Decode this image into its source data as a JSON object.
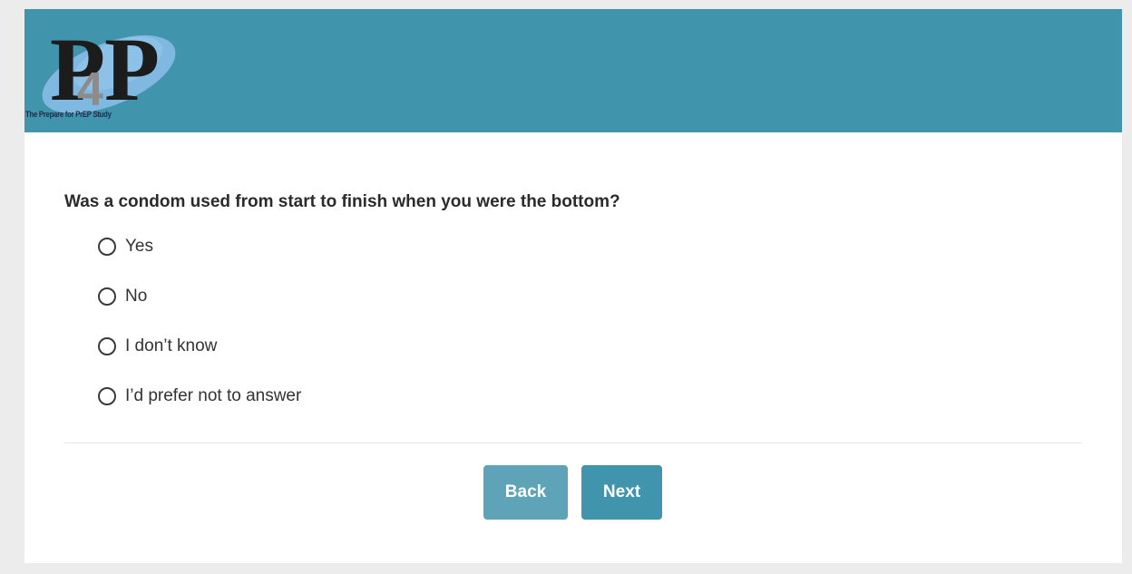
{
  "header": {
    "logo_text": "P4P",
    "tagline": "The Prepare for PrEP Study",
    "background_color": "#4095ad"
  },
  "question": {
    "text": "Was a condom used from start to finish when you were the bottom?",
    "options": [
      {
        "label": "Yes",
        "selected": false
      },
      {
        "label": "No",
        "selected": false
      },
      {
        "label": "I don’t know",
        "selected": false
      },
      {
        "label": "I’d prefer not to answer",
        "selected": false
      }
    ]
  },
  "navigation": {
    "back_label": "Back",
    "next_label": "Next",
    "back_color": "#5fa3b8",
    "next_color": "#4095ad"
  }
}
